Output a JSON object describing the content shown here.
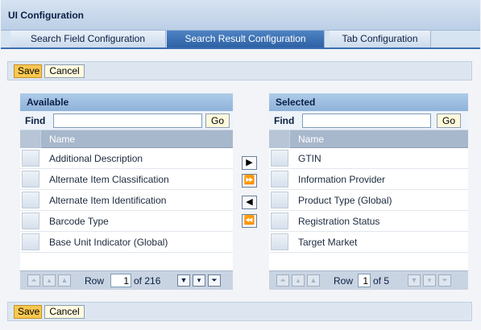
{
  "window": {
    "title": "UI Configuration"
  },
  "tabs": [
    {
      "label": "Search Field Configuration",
      "active": false
    },
    {
      "label": "Search Result Configuration",
      "active": true
    },
    {
      "label": "Tab Configuration",
      "active": false
    }
  ],
  "toolbar": {
    "save_label": "Save",
    "cancel_label": "Cancel"
  },
  "available": {
    "header": "Available",
    "find_label": "Find",
    "find_value": "",
    "go_label": "Go",
    "column": "Name",
    "rows": [
      "Additional Description",
      "Alternate Item Classification",
      "Alternate Item Identification",
      "Barcode Type",
      "Base Unit Indicator (Global)"
    ],
    "pager": {
      "row_label": "Row",
      "row_value": "1",
      "of_label": "of 216"
    }
  },
  "selected": {
    "header": "Selected",
    "find_label": "Find",
    "find_value": "",
    "go_label": "Go",
    "column": "Name",
    "rows": [
      "GTIN",
      "Information Provider",
      "Product Type (Global)",
      "Registration Status",
      "Target Market"
    ],
    "pager": {
      "row_label": "Row",
      "row_value": "1",
      "of_label": "of 5"
    }
  },
  "movers": [
    {
      "name": "move-right-icon",
      "glyph": "▶"
    },
    {
      "name": "move-all-right-icon",
      "glyph": "⏩"
    },
    {
      "name": "move-left-icon",
      "glyph": "◀"
    },
    {
      "name": "move-all-left-icon",
      "glyph": "⏪"
    }
  ],
  "colors": {
    "accent": "#3c6fb1",
    "save_button": "#f9c84f",
    "header": "#8fb2da"
  }
}
